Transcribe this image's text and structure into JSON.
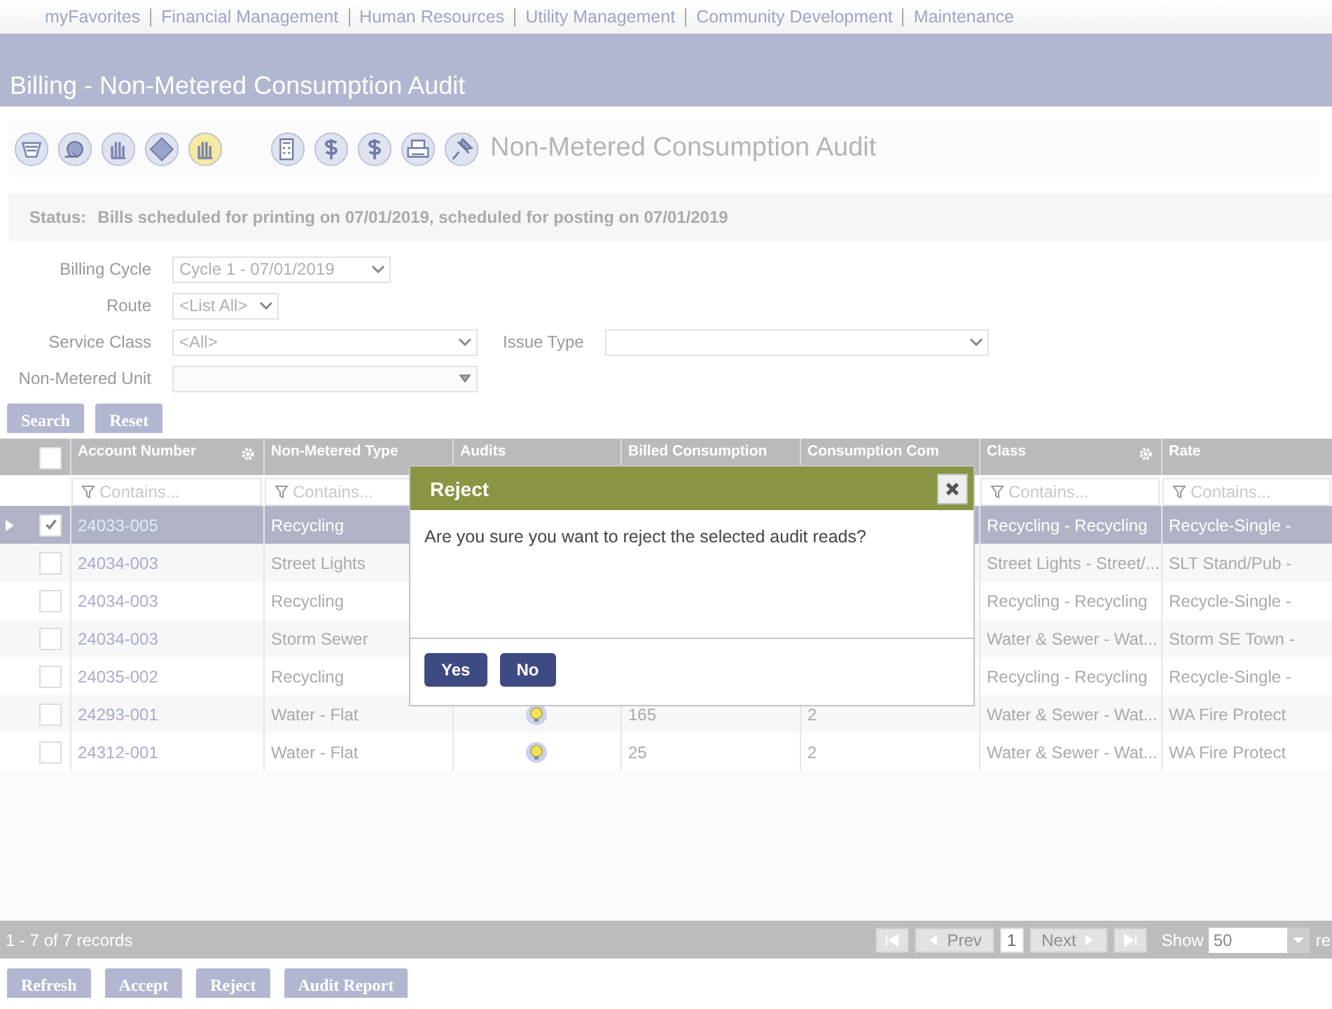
{
  "nav": [
    "myFavorites",
    "Financial Management",
    "Human Resources",
    "Utility Management",
    "Community Development",
    "Maintenance"
  ],
  "page_title": "Billing - Non-Metered Consumption Audit",
  "toolbar": {
    "title": "Non-Metered Consumption Audit"
  },
  "status": {
    "label": "Status:",
    "text": "Bills scheduled for printing on 07/01/2019, scheduled for posting on 07/01/2019"
  },
  "filters": [
    {
      "label": "Billing Cycle",
      "value": "Cycle 1 - 07/01/2019",
      "disabled": false
    },
    {
      "label": "Route",
      "value": "<List All>",
      "disabled": false
    },
    {
      "label": "Service Class",
      "value": "<All>",
      "disabled": false,
      "side": {
        "label": "Issue Type"
      }
    },
    {
      "label": "Non-Metered Unit",
      "disabled": true
    }
  ],
  "form_buttons": [
    "Search",
    "Reset"
  ],
  "table": {
    "select_all_checked": false,
    "columns": [
      {
        "label": "Account Number",
        "gear": true,
        "filter": "Contains..."
      },
      {
        "label": "Non-Metered Type",
        "gear": false,
        "filter": "Contains..."
      },
      {
        "label": "Audits",
        "gear": false
      },
      {
        "label": "Billed Consumption",
        "gear": false
      },
      {
        "label": "Consumption Com",
        "gear": false
      },
      {
        "label": "Class",
        "gear": true,
        "filter": "Contains..."
      },
      {
        "label": "Rate",
        "gear": false,
        "filter": "Contains..."
      }
    ],
    "rows": [
      {
        "selected": true,
        "checked": true,
        "cells": [
          "24033-005",
          "Recycling",
          null,
          null,
          null,
          "Recycling - Recycling",
          "Recycle-Single -"
        ]
      },
      {
        "selected": false,
        "checked": false,
        "cells": [
          "24034-003",
          "Street Lights",
          null,
          null,
          null,
          "Street Lights - Street/...",
          "SLT Stand/Pub -"
        ]
      },
      {
        "selected": false,
        "checked": false,
        "cells": [
          "24034-003",
          "Recycling",
          null,
          null,
          null,
          "Recycling - Recycling",
          "Recycle-Single -"
        ]
      },
      {
        "selected": false,
        "checked": false,
        "cells": [
          "24034-003",
          "Storm Sewer",
          null,
          null,
          null,
          "Water & Sewer - Wat...",
          "Storm SE Town -"
        ]
      },
      {
        "selected": false,
        "checked": false,
        "cells": [
          "24035-002",
          "Recycling",
          null,
          null,
          null,
          "Recycling - Recycling",
          "Recycle-Single -"
        ]
      },
      {
        "selected": false,
        "checked": false,
        "audit_icon": true,
        "cells": [
          "24293-001",
          "Water - Flat",
          null,
          "165",
          "2",
          "Water & Sewer - Wat...",
          "WA Fire Protect"
        ]
      },
      {
        "selected": false,
        "checked": false,
        "audit_icon": true,
        "cells": [
          "24312-001",
          "Water - Flat",
          null,
          "25",
          "2",
          "Water & Sewer - Wat...",
          "WA Fire Protect"
        ]
      }
    ]
  },
  "pager": {
    "summary": "1 - 7 of 7 records",
    "prev": "Prev",
    "page": "1",
    "next": "Next",
    "show_label": "Show",
    "page_size": "50",
    "tail": "re"
  },
  "actions": [
    "Refresh",
    "Accept",
    "Reject",
    "Audit Report"
  ],
  "dialog": {
    "title": "Reject",
    "message": "Are you sure you want to reject the selected audit reads?",
    "buttons": [
      "Yes",
      "No"
    ]
  }
}
